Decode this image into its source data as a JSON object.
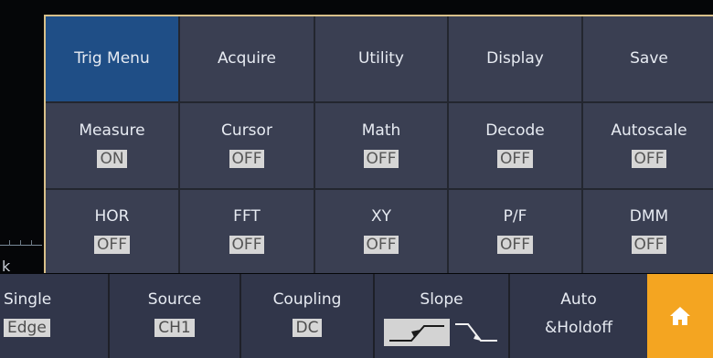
{
  "scope": {
    "time_suffix": "k"
  },
  "menu": {
    "row1": [
      {
        "label": "Trig Menu",
        "active": true
      },
      {
        "label": "Acquire"
      },
      {
        "label": "Utility"
      },
      {
        "label": "Display"
      },
      {
        "label": "Save"
      }
    ],
    "row2": [
      {
        "label": "Measure",
        "state": "ON"
      },
      {
        "label": "Cursor",
        "state": "OFF"
      },
      {
        "label": "Math",
        "state": "OFF"
      },
      {
        "label": "Decode",
        "state": "OFF"
      },
      {
        "label": "Autoscale",
        "state": "OFF"
      }
    ],
    "row3": [
      {
        "label": "HOR",
        "state": "OFF"
      },
      {
        "label": "FFT",
        "state": "OFF"
      },
      {
        "label": "XY",
        "state": "OFF"
      },
      {
        "label": "P/F",
        "state": "OFF"
      },
      {
        "label": "DMM",
        "state": "OFF"
      }
    ]
  },
  "bottom_bar": {
    "single": {
      "label": "Single",
      "value": "Edge"
    },
    "source": {
      "label": "Source",
      "value": "CH1"
    },
    "coupling": {
      "label": "Coupling",
      "value": "DC"
    },
    "slope": {
      "label": "Slope",
      "selected": "rising-edge-icon",
      "alternate": "falling-edge-icon"
    },
    "mode": {
      "label": "Auto",
      "value": "&Holdoff"
    },
    "home": {
      "icon": "home-icon",
      "color": "#f4a521"
    }
  },
  "colors": {
    "active_menu": "#1f4e86",
    "menu_bg": "#3a3f52",
    "border_accent": "#d8c08a"
  }
}
